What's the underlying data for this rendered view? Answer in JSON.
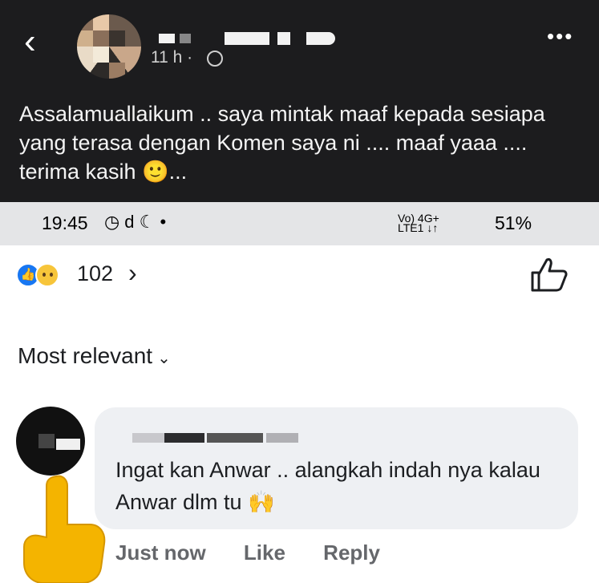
{
  "post": {
    "back_icon": "back-arrow-icon",
    "time": "11 h ·",
    "privacy_icon": "globe-icon",
    "more_icon": "more-dots-icon",
    "more_label": "•••",
    "text": "Assalamuallaikum .. saya mintak maaf kepada sesiapa yang terasa dengan Komen saya ni .... maaf yaaa .... terima kasih 🙂..."
  },
  "status_bar": {
    "time": "19:45",
    "icons_left": "◷ d ☾ •",
    "network": "Vo) 4G+",
    "network2": "LTE1 ↓↑",
    "battery": "51%"
  },
  "reactions": {
    "count": "102",
    "arrow": "›",
    "like_icon": "like-reaction-icon",
    "sad_icon": "sad-reaction-icon",
    "thumb_icon": "thumbs-up-icon"
  },
  "sort": {
    "label": "Most relevant",
    "chevron": "⌄"
  },
  "comment": {
    "text": "Ingat kan Anwar .. alangkah indah nya kalau Anwar dlm tu 🙌",
    "actions": {
      "time": "Just now",
      "like": "Like",
      "reply": "Reply"
    }
  },
  "colors": {
    "top_bg": "#1c1c1e",
    "status_bg": "#e4e5e7",
    "bubble_bg": "#eef0f3",
    "accent": "#1877f2",
    "muted": "#65676b"
  }
}
